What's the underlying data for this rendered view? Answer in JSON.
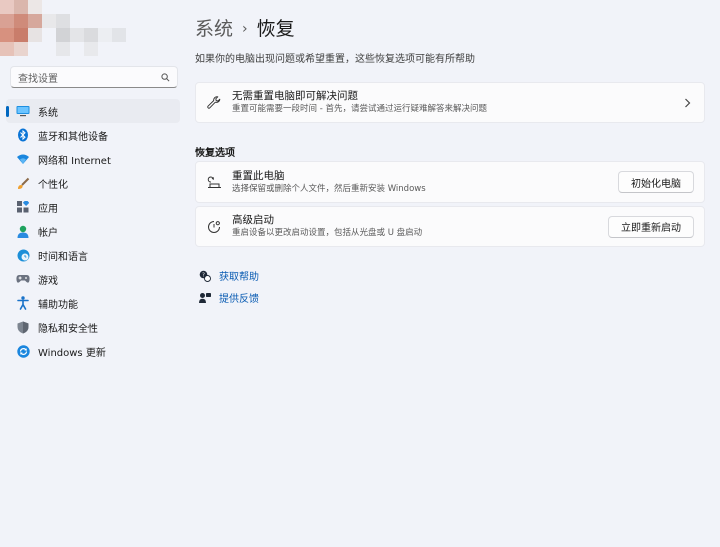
{
  "sidebar": {
    "search_placeholder": "查找设置",
    "items": [
      {
        "label": "系统",
        "icon": "monitor-icon",
        "active": true
      },
      {
        "label": "蓝牙和其他设备",
        "icon": "bluetooth-icon"
      },
      {
        "label": "网络和 Internet",
        "icon": "wifi-icon"
      },
      {
        "label": "个性化",
        "icon": "brush-icon"
      },
      {
        "label": "应用",
        "icon": "apps-icon"
      },
      {
        "label": "帐户",
        "icon": "person-icon"
      },
      {
        "label": "时间和语言",
        "icon": "globe-clock-icon"
      },
      {
        "label": "游戏",
        "icon": "gamepad-icon"
      },
      {
        "label": "辅助功能",
        "icon": "accessibility-icon"
      },
      {
        "label": "隐私和安全性",
        "icon": "shield-icon"
      },
      {
        "label": "Windows 更新",
        "icon": "update-icon"
      }
    ]
  },
  "header": {
    "breadcrumb_parent": "系统",
    "separator": "›",
    "title": "恢复",
    "subtitle": "如果你的电脑出现问题或希望重置，这些恢复选项可能有所帮助"
  },
  "troubleshoot": {
    "title": "无需重置电脑即可解决问题",
    "desc": "重置可能需要一段时间 - 首先，请尝试通过运行疑难解答来解决问题"
  },
  "recovery": {
    "section_title": "恢复选项",
    "reset": {
      "title": "重置此电脑",
      "desc": "选择保留或删除个人文件，然后重新安装 Windows",
      "button": "初始化电脑"
    },
    "advanced": {
      "title": "高级启动",
      "desc": "重启设备以更改启动设置，包括从光盘或 U 盘启动",
      "button": "立即重新启动"
    }
  },
  "links": {
    "help": "获取帮助",
    "feedback": "提供反馈"
  },
  "colors": {
    "accent": "#0067c0",
    "link": "#0a5cb3",
    "background": "#f1f3f9"
  }
}
